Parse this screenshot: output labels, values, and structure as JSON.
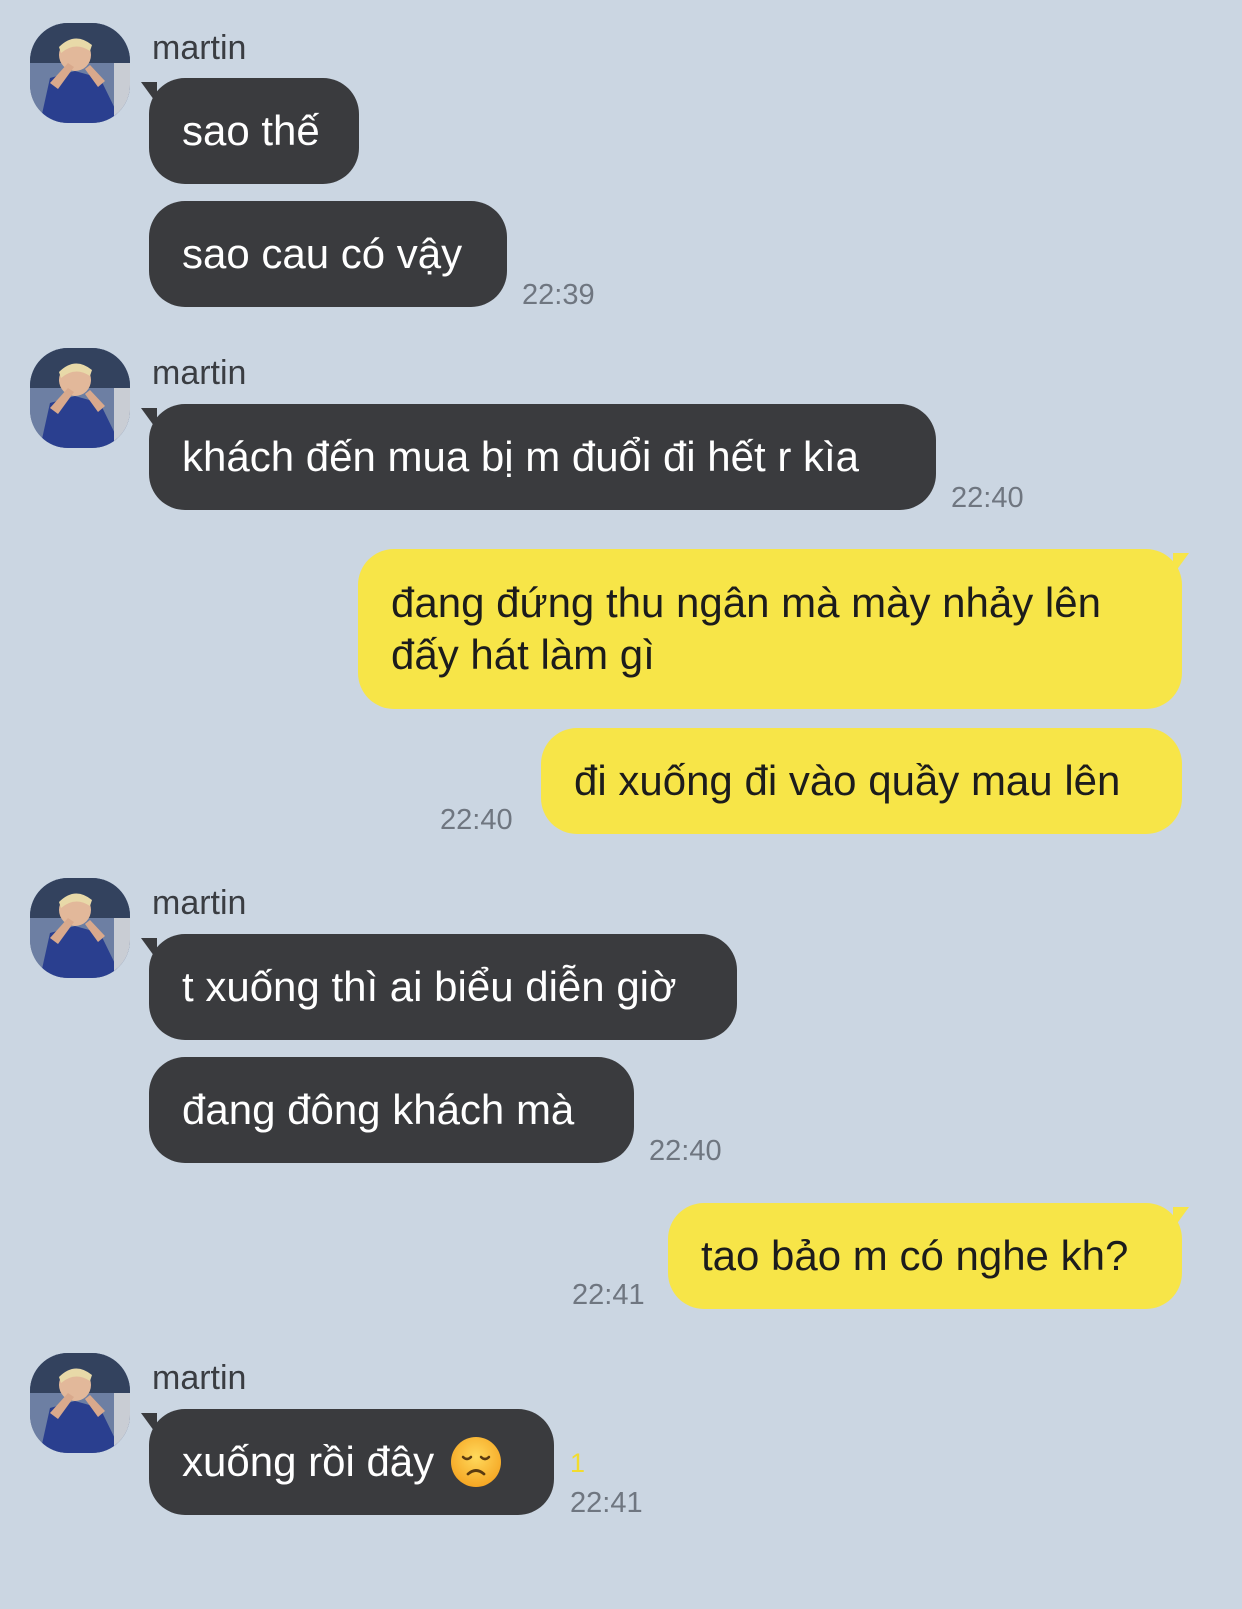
{
  "colors": {
    "background": "#cbd6e2",
    "incoming_bubble": "#3a3b3e",
    "outgoing_bubble": "#f7e548",
    "timestamp": "#6f7680",
    "unread_count": "#f2dc2e"
  },
  "groups": [
    {
      "sender": "martin",
      "avatar_icon": "profile-photo-icon",
      "messages": [
        "sao thế",
        "sao cau có vậy"
      ],
      "time": "22:39"
    },
    {
      "sender": "martin",
      "avatar_icon": "profile-photo-icon",
      "messages": [
        "khách đến mua bị m đuổi đi hết r kìa"
      ],
      "time": "22:40"
    },
    {
      "sender": "me",
      "messages": [
        "đang đứng thu ngân mà mày nhảy lên đấy hát làm gì",
        "đi xuống đi vào quầy mau lên"
      ],
      "time": "22:40"
    },
    {
      "sender": "martin",
      "avatar_icon": "profile-photo-icon",
      "messages": [
        "t xuống thì ai biểu diễn giờ",
        "đang đông khách mà"
      ],
      "time": "22:40"
    },
    {
      "sender": "me",
      "messages": [
        "tao bảo m có nghe kh?"
      ],
      "time": "22:41"
    },
    {
      "sender": "martin",
      "avatar_icon": "profile-photo-icon",
      "messages": [
        "xuống rồi đây"
      ],
      "emoji": "disappointed-face-icon",
      "unread_count": "1",
      "time": "22:41"
    }
  ]
}
